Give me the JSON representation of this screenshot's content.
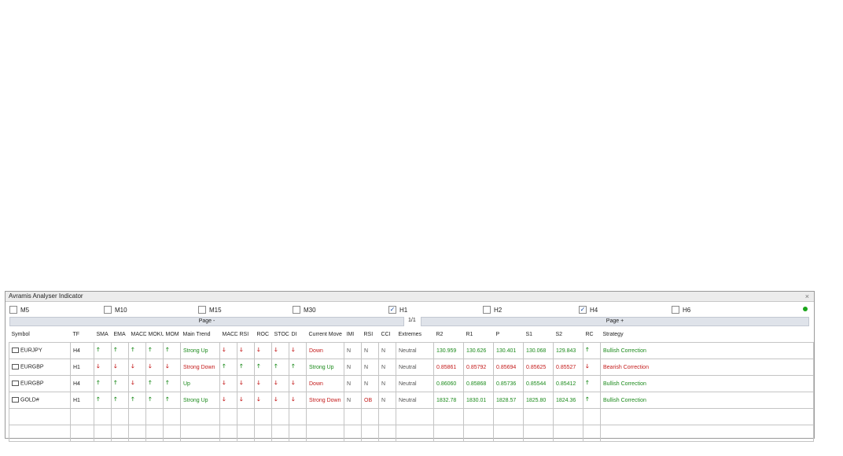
{
  "panel": {
    "title": "Avramis Analyser Indicator",
    "close_label": "×"
  },
  "timeframes": [
    {
      "label": "M5",
      "checked": false
    },
    {
      "label": "M10",
      "checked": false
    },
    {
      "label": "M15",
      "checked": false
    },
    {
      "label": "M30",
      "checked": false
    },
    {
      "label": "H1",
      "checked": true
    },
    {
      "label": "H2",
      "checked": false
    },
    {
      "label": "H4",
      "checked": true
    },
    {
      "label": "H6",
      "checked": false
    }
  ],
  "pager": {
    "prev": "Page -",
    "indicator": "1/1",
    "next": "Page +"
  },
  "table": {
    "headers": [
      "Symbol",
      "TF",
      "SMA",
      "EMA",
      "MACD",
      "MOKU",
      "MOM",
      "Main Trend",
      "MACD",
      "RSI",
      "ROC",
      "STOCH",
      "DI",
      "Current Move",
      "IMI",
      "RSI",
      "CCI",
      "Extremes",
      "R2",
      "R1",
      "P",
      "S1",
      "S2",
      "RC",
      "Strategy"
    ],
    "rows": [
      {
        "symbol": "EURJPY",
        "tf": "H4",
        "sma": "up",
        "ema": "up",
        "macd": "up",
        "moku": "up",
        "mom": "up",
        "main_trend": "Strong Up",
        "main_trend_dir": "up",
        "macd2": "down",
        "rsi": "down",
        "roc": "down",
        "stoch": "down",
        "di": "down",
        "current_move": "Down",
        "current_move_dir": "down",
        "imi": "N",
        "rsi2": "N",
        "cci": "N",
        "extremes": "Neutral",
        "r2": "130.959",
        "r1": "130.626",
        "p": "130.401",
        "s1": "130.068",
        "s2": "129.843",
        "levels_dir": "up",
        "rc": "up",
        "strategy": "Bullish Correction",
        "strategy_dir": "up"
      },
      {
        "symbol": "EURGBP",
        "tf": "H1",
        "sma": "down",
        "ema": "down",
        "macd": "down",
        "moku": "down",
        "mom": "down",
        "main_trend": "Strong Down",
        "main_trend_dir": "down",
        "macd2": "up",
        "rsi": "up",
        "roc": "up",
        "stoch": "up",
        "di": "up",
        "current_move": "Strong Up",
        "current_move_dir": "up",
        "imi": "N",
        "rsi2": "N",
        "cci": "N",
        "extremes": "Neutral",
        "r2": "0.85861",
        "r1": "0.85792",
        "p": "0.85694",
        "s1": "0.85625",
        "s2": "0.85527",
        "levels_dir": "down",
        "rc": "down",
        "strategy": "Bearish Correction",
        "strategy_dir": "down"
      },
      {
        "symbol": "EURGBP",
        "tf": "H4",
        "sma": "up",
        "ema": "up",
        "macd": "down",
        "moku": "up",
        "mom": "up",
        "main_trend": "Up",
        "main_trend_dir": "up",
        "macd2": "down",
        "rsi": "down",
        "roc": "down",
        "stoch": "down",
        "di": "down",
        "current_move": "Down",
        "current_move_dir": "down",
        "imi": "N",
        "rsi2": "N",
        "cci": "N",
        "extremes": "Neutral",
        "r2": "0.86060",
        "r1": "0.85868",
        "p": "0.85736",
        "s1": "0.85544",
        "s2": "0.85412",
        "levels_dir": "up",
        "rc": "up",
        "strategy": "Bullish Correction",
        "strategy_dir": "up"
      },
      {
        "symbol": "GOLD#",
        "tf": "H1",
        "sma": "up",
        "ema": "up",
        "macd": "up",
        "moku": "up",
        "mom": "up",
        "main_trend": "Strong Up",
        "main_trend_dir": "up",
        "macd2": "down",
        "rsi": "down",
        "roc": "down",
        "stoch": "down",
        "di": "down",
        "current_move": "Strong Down",
        "current_move_dir": "down",
        "imi": "N",
        "rsi2": "OB",
        "cci": "N",
        "extremes": "Neutral",
        "r2": "1832.78",
        "r1": "1830.01",
        "p": "1828.57",
        "s1": "1825.80",
        "s2": "1824.36",
        "levels_dir": "up",
        "rc": "up",
        "strategy": "Bullish Correction",
        "strategy_dir": "up"
      }
    ],
    "empty_rows": 2
  },
  "glyphs": {
    "up": "🡑",
    "down": "🡓",
    "check": "✓"
  },
  "colors": {
    "up": "#1b8a1b",
    "down": "#c41b1b",
    "status": "#1aa51a"
  }
}
